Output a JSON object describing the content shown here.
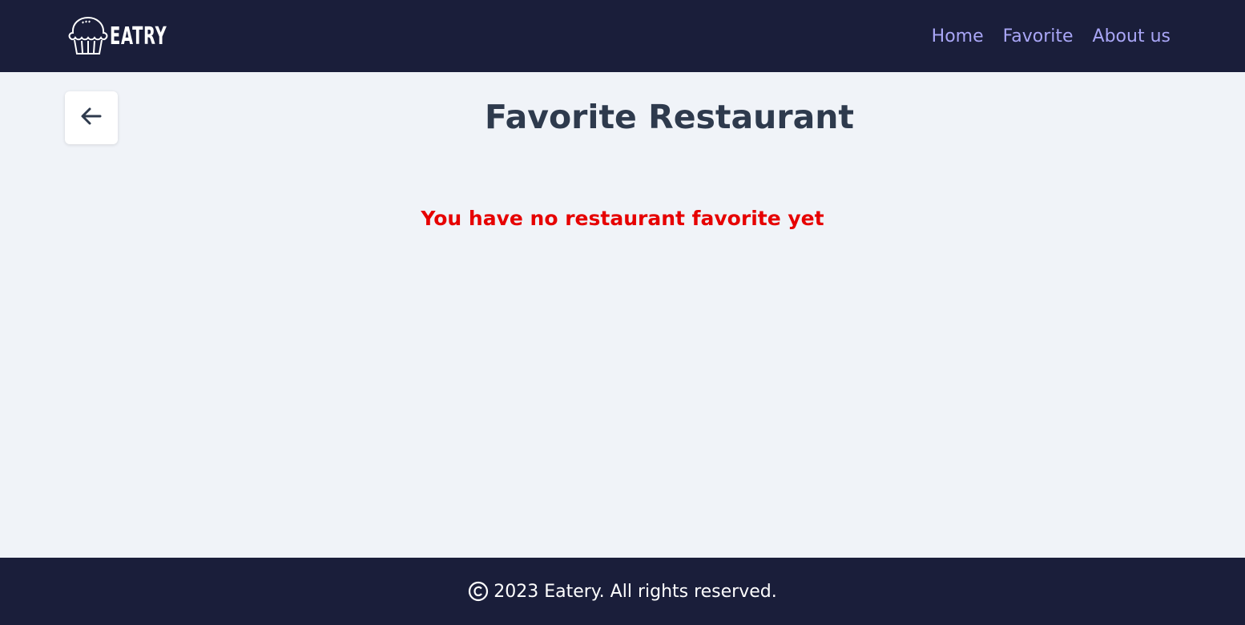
{
  "header": {
    "logo_text": "EATRY",
    "nav": [
      {
        "label": "Home"
      },
      {
        "label": "Favorite"
      },
      {
        "label": "About us"
      }
    ]
  },
  "main": {
    "back_icon": "arrow-left-icon",
    "title": "Favorite Restaurant",
    "empty_message": "You have no restaurant favorite yet"
  },
  "footer": {
    "copyright_icon": "copyright-icon",
    "text": "2023 Eatery. All rights reserved."
  },
  "colors": {
    "header_bg": "#1a1e3a",
    "footer_bg": "#1a1e3a",
    "page_bg": "#f0f3f8",
    "nav_link": "#a9a6f6",
    "title": "#2e3a4d",
    "empty_message": "#e60000"
  }
}
